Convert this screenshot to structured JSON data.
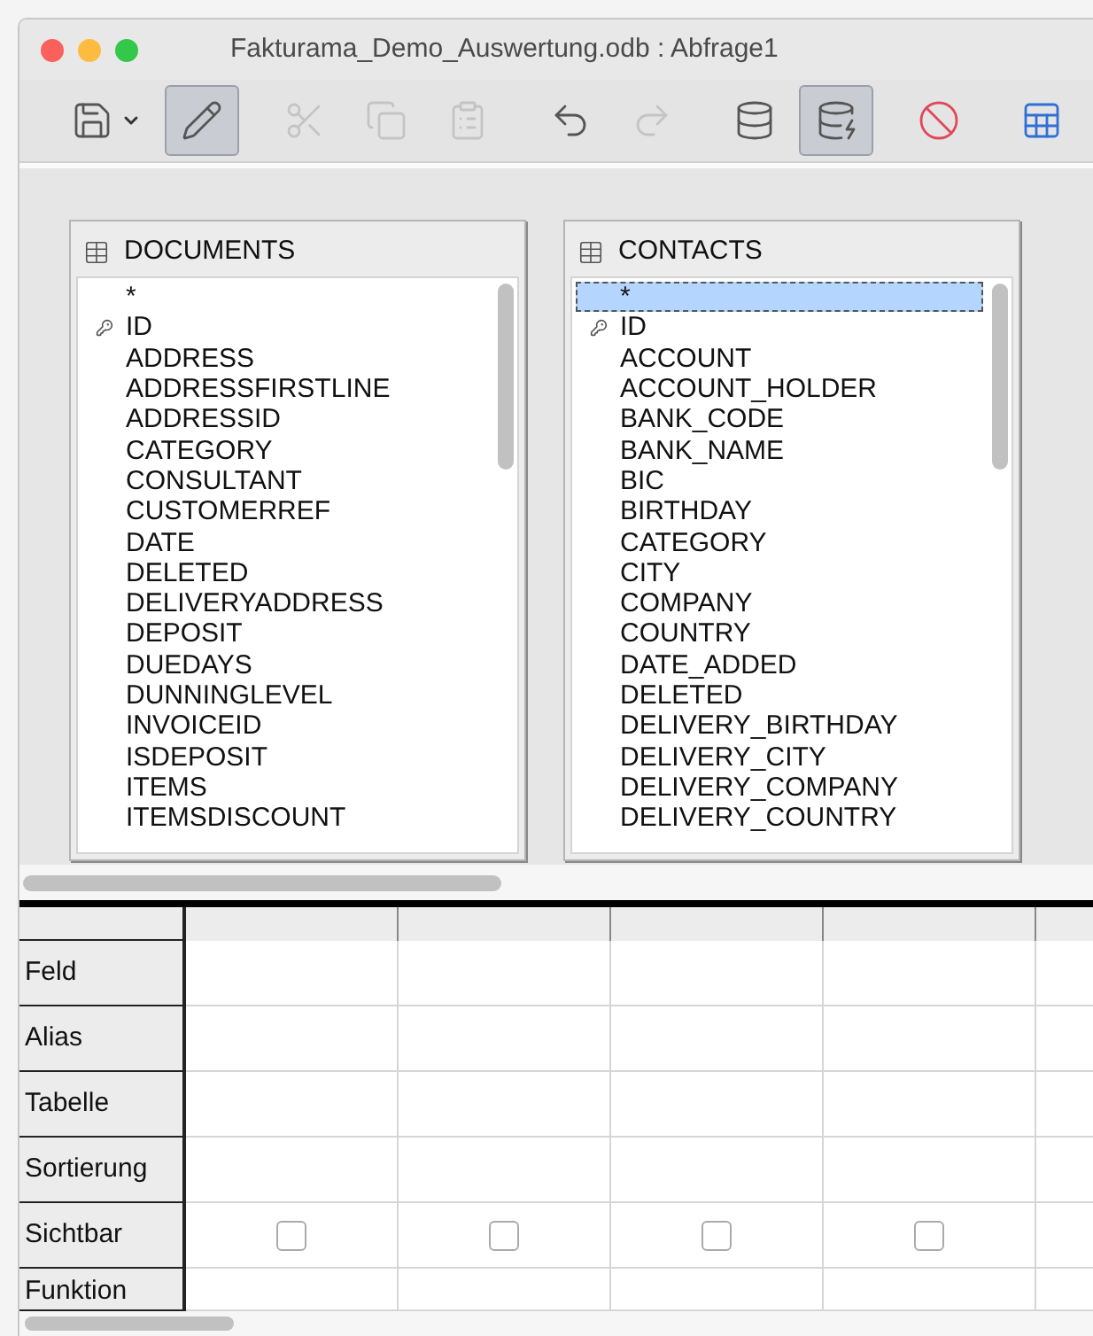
{
  "window": {
    "title": "Fakturama_Demo_Auswertung.odb : Abfrage1"
  },
  "toolbar": [
    {
      "kind": "save",
      "pressed": false,
      "disabled": false
    },
    {
      "kind": "edit",
      "pressed": true,
      "disabled": false
    },
    {
      "kind": "cut",
      "pressed": false,
      "disabled": true
    },
    {
      "kind": "copy",
      "pressed": false,
      "disabled": true
    },
    {
      "kind": "paste",
      "pressed": false,
      "disabled": true
    },
    {
      "kind": "undo",
      "pressed": false,
      "disabled": false
    },
    {
      "kind": "redo",
      "pressed": false,
      "disabled": true
    },
    {
      "kind": "add-table",
      "pressed": false,
      "disabled": false
    },
    {
      "kind": "design-view",
      "pressed": true,
      "disabled": false
    },
    {
      "kind": "clear",
      "pressed": false,
      "disabled": false
    },
    {
      "kind": "functions",
      "pressed": false,
      "disabled": false
    }
  ],
  "tables": [
    {
      "title": "DOCUMENTS",
      "fields": [
        {
          "name": "*",
          "key": false,
          "selected": false
        },
        {
          "name": "ID",
          "key": true,
          "selected": false
        },
        {
          "name": "ADDRESS",
          "key": false,
          "selected": false
        },
        {
          "name": "ADDRESSFIRSTLINE",
          "key": false,
          "selected": false
        },
        {
          "name": "ADDRESSID",
          "key": false,
          "selected": false
        },
        {
          "name": "CATEGORY",
          "key": false,
          "selected": false
        },
        {
          "name": "CONSULTANT",
          "key": false,
          "selected": false
        },
        {
          "name": "CUSTOMERREF",
          "key": false,
          "selected": false
        },
        {
          "name": "DATE",
          "key": false,
          "selected": false
        },
        {
          "name": "DELETED",
          "key": false,
          "selected": false
        },
        {
          "name": "DELIVERYADDRESS",
          "key": false,
          "selected": false
        },
        {
          "name": "DEPOSIT",
          "key": false,
          "selected": false
        },
        {
          "name": "DUEDAYS",
          "key": false,
          "selected": false
        },
        {
          "name": "DUNNINGLEVEL",
          "key": false,
          "selected": false
        },
        {
          "name": "INVOICEID",
          "key": false,
          "selected": false
        },
        {
          "name": "ISDEPOSIT",
          "key": false,
          "selected": false
        },
        {
          "name": "ITEMS",
          "key": false,
          "selected": false
        },
        {
          "name": "ITEMSDISCOUNT",
          "key": false,
          "selected": false
        }
      ]
    },
    {
      "title": "CONTACTS",
      "fields": [
        {
          "name": "*",
          "key": false,
          "selected": true
        },
        {
          "name": "ID",
          "key": true,
          "selected": false
        },
        {
          "name": "ACCOUNT",
          "key": false,
          "selected": false
        },
        {
          "name": "ACCOUNT_HOLDER",
          "key": false,
          "selected": false
        },
        {
          "name": "BANK_CODE",
          "key": false,
          "selected": false
        },
        {
          "name": "BANK_NAME",
          "key": false,
          "selected": false
        },
        {
          "name": "BIC",
          "key": false,
          "selected": false
        },
        {
          "name": "BIRTHDAY",
          "key": false,
          "selected": false
        },
        {
          "name": "CATEGORY",
          "key": false,
          "selected": false
        },
        {
          "name": "CITY",
          "key": false,
          "selected": false
        },
        {
          "name": "COMPANY",
          "key": false,
          "selected": false
        },
        {
          "name": "COUNTRY",
          "key": false,
          "selected": false
        },
        {
          "name": "DATE_ADDED",
          "key": false,
          "selected": false
        },
        {
          "name": "DELETED",
          "key": false,
          "selected": false
        },
        {
          "name": "DELIVERY_BIRTHDAY",
          "key": false,
          "selected": false
        },
        {
          "name": "DELIVERY_CITY",
          "key": false,
          "selected": false
        },
        {
          "name": "DELIVERY_COMPANY",
          "key": false,
          "selected": false
        },
        {
          "name": "DELIVERY_COUNTRY",
          "key": false,
          "selected": false
        }
      ]
    }
  ],
  "grid": {
    "rows": [
      {
        "label": "Feld"
      },
      {
        "label": "Alias"
      },
      {
        "label": "Tabelle"
      },
      {
        "label": "Sortierung"
      },
      {
        "label": "Sichtbar",
        "checkboxes": [
          {
            "checked": false
          },
          {
            "checked": false
          },
          {
            "checked": false
          },
          {
            "checked": false
          }
        ]
      },
      {
        "label": "Funktion"
      }
    ]
  }
}
